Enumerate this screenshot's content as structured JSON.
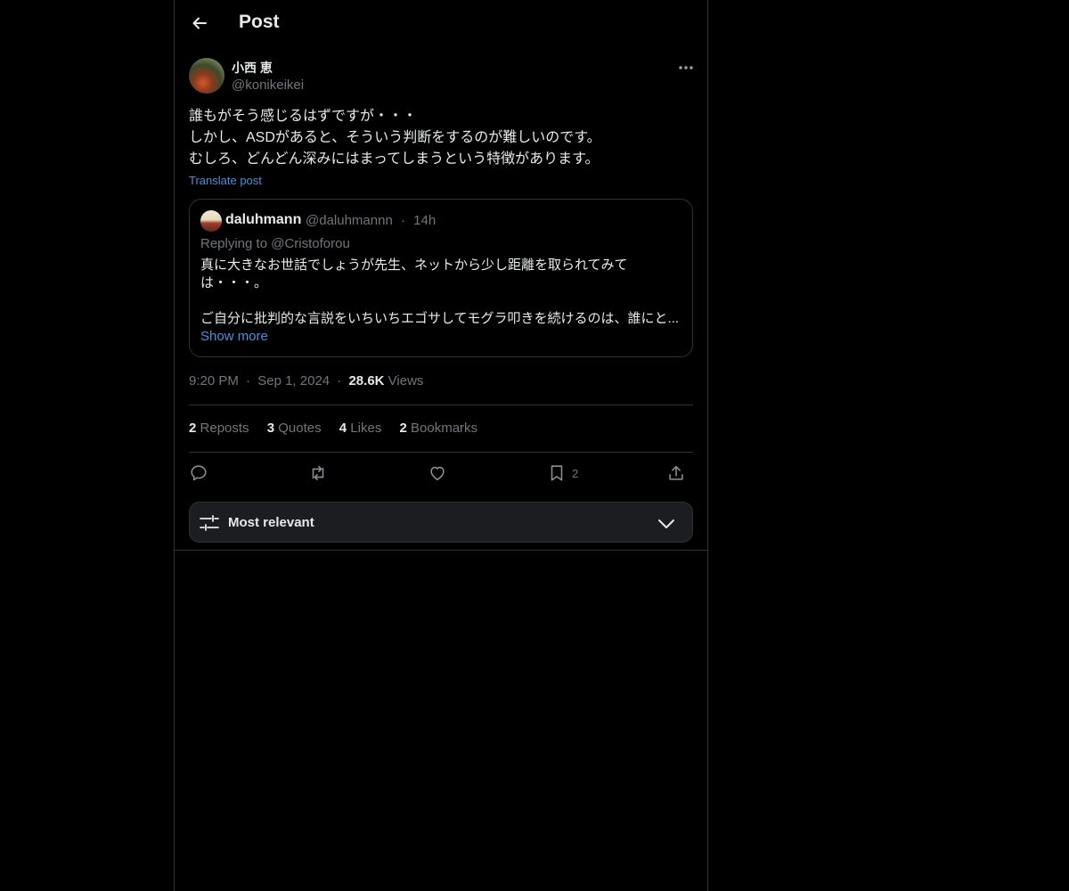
{
  "header": {
    "title": "Post"
  },
  "post": {
    "author_name": "小西 恵",
    "author_handle": "@konikeikei",
    "text_lines": [
      "誰もがそう感じるはずですが・・・",
      "しかし、ASDがあると、そういう判断をするのが難しいのです。",
      "むしろ、どんどん深みにはまってしまうという特徴があります。"
    ],
    "translate_label": "Translate post",
    "time": "9:20 PM",
    "date": "Sep 1, 2024",
    "views_count": "28.6K",
    "views_label": "Views",
    "separator": "·"
  },
  "quote": {
    "name": "daluhmann",
    "handle": "@daluhmannn",
    "age": "14h",
    "replying_to": "Replying to @Cristoforou",
    "text_lines": [
      "真に大きなお世話でしょうが先生、ネットから少し距離を取られてみて",
      "は・・・。",
      "",
      "ご自分に批判的な言説をいちいちエゴサしてモグラ叩きを続けるのは、誰にと..."
    ],
    "show_more": "Show more"
  },
  "stats": [
    {
      "count": "2",
      "label": "Reposts"
    },
    {
      "count": "3",
      "label": "Quotes"
    },
    {
      "count": "4",
      "label": "Likes"
    },
    {
      "count": "2",
      "label": "Bookmarks"
    }
  ],
  "actions": {
    "reply_icon": "reply-icon",
    "repost_icon": "repost-icon",
    "like_icon": "heart-icon",
    "bookmark_icon": "bookmark-icon",
    "bookmark_count": "2",
    "share_icon": "share-icon"
  },
  "sort": {
    "label": "Most relevant"
  },
  "colors": {
    "background": "#000000",
    "text": "#e7e9ea",
    "muted": "#71767b",
    "link": "#4f8fd9",
    "border": "#2f3336"
  }
}
